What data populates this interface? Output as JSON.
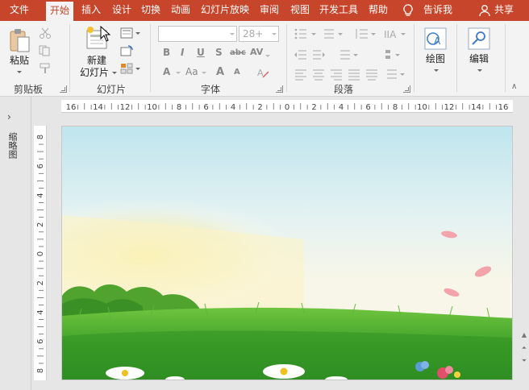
{
  "tabs": [
    {
      "label": "文件",
      "active": false
    },
    {
      "label": "开始",
      "active": true
    },
    {
      "label": "插入",
      "active": false
    },
    {
      "label": "设计",
      "active": false
    },
    {
      "label": "切换",
      "active": false
    },
    {
      "label": "动画",
      "active": false
    },
    {
      "label": "幻灯片放映",
      "active": false
    },
    {
      "label": "审阅",
      "active": false
    },
    {
      "label": "视图",
      "active": false
    },
    {
      "label": "开发工具",
      "active": false
    },
    {
      "label": "帮助",
      "active": false
    }
  ],
  "tell_me": "告诉我",
  "share": "共享",
  "ribbon": {
    "clipboard": {
      "paste_label": "粘贴",
      "group_label": "剪贴板"
    },
    "slides": {
      "new_slide_line1": "新建",
      "new_slide_line2": "幻灯片",
      "group_label": "幻灯片"
    },
    "font": {
      "font_size": "28+",
      "group_label": "字体",
      "letters": [
        "B",
        "I",
        "U",
        "S",
        "abc",
        "AV",
        "A",
        "Aa",
        "A",
        "A"
      ]
    },
    "paragraph": {
      "group_label": "段落"
    },
    "drawing": {
      "label": "绘图"
    },
    "editing": {
      "label": "编辑"
    }
  },
  "left_pane": {
    "label": "缩略图"
  },
  "hruler_ticks": [
    "16",
    "14",
    "12",
    "10",
    "8",
    "6",
    "4",
    "2",
    "0",
    "2",
    "4",
    "6",
    "8",
    "10",
    "12",
    "14",
    "16"
  ],
  "vruler_ticks": [
    "8",
    "6",
    "4",
    "2",
    "0",
    "2",
    "4",
    "6",
    "8"
  ],
  "colors": {
    "accent": "#c7462b",
    "ribbon_bg": "#f3f3f3",
    "app_bg": "#e6e6e6"
  }
}
